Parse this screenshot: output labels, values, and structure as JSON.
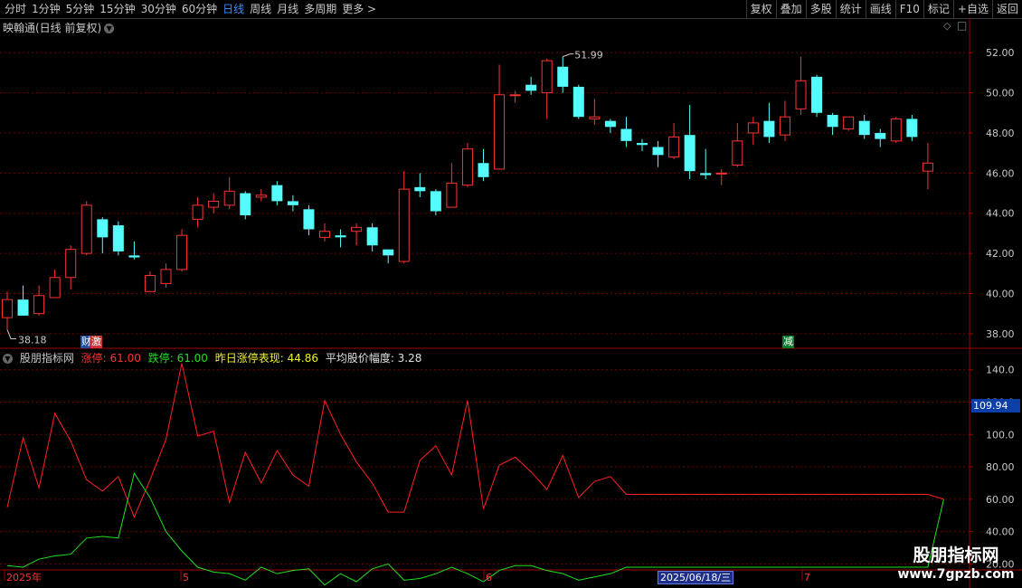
{
  "toolbar": {
    "periods": [
      "分时",
      "1分钟",
      "5分钟",
      "15分钟",
      "30分钟",
      "60分钟",
      "日线",
      "周线",
      "月线",
      "多周期",
      "更多 >"
    ],
    "active_period": "日线",
    "tools": [
      "复权",
      "叠加",
      "多股",
      "统计",
      "画线",
      "F10",
      "标记",
      "+自选",
      "返回"
    ]
  },
  "main_chart": {
    "title": "映翰通(日线 前复权)",
    "price_axis": [
      "52.00",
      "50.00",
      "48.00",
      "46.00",
      "44.00",
      "42.00",
      "40.00",
      "38.00"
    ],
    "high_label": "51.99",
    "low_label": "38.18",
    "badges": {
      "cai": "财",
      "ji": "激",
      "jian": "减"
    }
  },
  "indicator": {
    "name": "股朋指标网",
    "zt": "涨停: 61.00",
    "dt": "跌停: 61.00",
    "zrzt": "昨日涨停表现: 44.86",
    "avg": "平均股价幅度: 3.28",
    "axis": [
      "140.0",
      "120.0",
      "100.0",
      "80.00",
      "60.00",
      "40.00",
      "20.00"
    ],
    "current_value": "109.94"
  },
  "date_axis": {
    "labels": [
      "2025年",
      "5",
      "6",
      "7"
    ],
    "highlight": "2025/06/18/三"
  },
  "watermark": {
    "line1": "股朋指标网",
    "line2": "www.7gpzb.com"
  },
  "colors": {
    "up": "#ff3232",
    "down": "#54fcfc",
    "red_line": "#ff2020",
    "green_line": "#20e020",
    "grid": "#6e0000",
    "axis": "#a00000"
  },
  "chart_data": {
    "type": "candlestick",
    "ylim": [
      37.5,
      53
    ],
    "candles": [
      [
        38.8,
        39.7,
        40.1,
        38.2
      ],
      [
        39.7,
        38.9,
        40.4,
        38.9
      ],
      [
        39.0,
        39.9,
        40.4,
        38.9
      ],
      [
        39.8,
        40.8,
        41.2,
        39.8
      ],
      [
        40.8,
        42.2,
        42.4,
        40.2
      ],
      [
        42.0,
        44.4,
        44.6,
        41.9
      ],
      [
        43.7,
        42.8,
        43.8,
        42.0
      ],
      [
        43.4,
        42.1,
        43.6,
        41.9
      ],
      [
        41.9,
        41.8,
        42.6,
        41.7
      ],
      [
        40.1,
        40.9,
        41.1,
        40.1
      ],
      [
        40.5,
        41.2,
        41.5,
        40.3
      ],
      [
        41.2,
        42.9,
        43.2,
        41.1
      ],
      [
        43.7,
        44.4,
        44.8,
        43.3
      ],
      [
        44.3,
        44.6,
        45.0,
        44.0
      ],
      [
        44.4,
        45.1,
        45.8,
        44.2
      ],
      [
        45.0,
        43.9,
        45.1,
        43.7
      ],
      [
        44.8,
        44.9,
        45.2,
        44.6
      ],
      [
        45.4,
        44.6,
        45.6,
        44.4
      ],
      [
        44.6,
        44.4,
        44.9,
        44.1
      ],
      [
        44.2,
        43.2,
        44.4,
        42.9
      ],
      [
        42.8,
        43.1,
        43.5,
        42.6
      ],
      [
        42.9,
        42.8,
        43.2,
        42.3
      ],
      [
        43.1,
        43.3,
        43.5,
        42.4
      ],
      [
        43.3,
        42.4,
        43.5,
        42.1
      ],
      [
        42.2,
        41.9,
        42.2,
        41.5
      ],
      [
        41.6,
        45.2,
        46.1,
        41.5
      ],
      [
        45.3,
        45.1,
        46.0,
        44.8
      ],
      [
        45.1,
        44.1,
        45.2,
        43.9
      ],
      [
        44.3,
        45.5,
        46.5,
        44.3
      ],
      [
        45.4,
        47.2,
        47.5,
        45.3
      ],
      [
        46.5,
        45.8,
        47.2,
        45.6
      ],
      [
        46.2,
        49.9,
        51.4,
        46.2
      ],
      [
        49.9,
        49.9,
        50.1,
        49.5
      ],
      [
        50.4,
        50.1,
        50.8,
        49.9
      ],
      [
        50.0,
        51.6,
        51.7,
        48.7
      ],
      [
        51.3,
        50.3,
        51.8,
        50.0
      ],
      [
        50.3,
        48.8,
        50.4,
        48.7
      ],
      [
        48.7,
        48.8,
        49.7,
        48.4
      ],
      [
        48.6,
        48.3,
        48.7,
        48.0
      ],
      [
        48.2,
        47.6,
        48.8,
        47.3
      ],
      [
        47.5,
        47.4,
        47.7,
        47.1
      ],
      [
        47.3,
        46.9,
        47.6,
        46.3
      ],
      [
        46.8,
        47.8,
        48.5,
        46.7
      ],
      [
        47.9,
        46.1,
        49.4,
        45.7
      ],
      [
        46.0,
        45.9,
        47.2,
        45.7
      ],
      [
        46.0,
        46.0,
        46.2,
        45.4
      ],
      [
        46.4,
        47.6,
        48.5,
        46.3
      ],
      [
        48.0,
        48.5,
        48.8,
        47.4
      ],
      [
        48.6,
        47.8,
        49.5,
        47.5
      ],
      [
        47.9,
        48.8,
        49.6,
        47.6
      ],
      [
        49.2,
        50.6,
        51.8,
        48.9
      ],
      [
        50.8,
        49.0,
        50.9,
        48.8
      ],
      [
        48.9,
        48.3,
        49.0,
        47.9
      ],
      [
        48.2,
        48.8,
        48.8,
        48.1
      ],
      [
        48.6,
        47.9,
        48.9,
        47.7
      ],
      [
        48.0,
        47.7,
        48.2,
        47.3
      ],
      [
        47.6,
        48.7,
        48.8,
        47.5
      ],
      [
        48.7,
        47.8,
        48.9,
        47.6
      ],
      [
        46.1,
        46.5,
        47.5,
        45.2
      ]
    ],
    "indicator_ylim": [
      18,
      146
    ],
    "red_series": [
      55,
      98,
      67,
      113,
      96,
      72,
      65,
      74,
      49,
      72,
      97,
      144,
      99,
      102,
      58,
      89,
      70,
      90,
      75,
      68,
      121,
      100,
      83,
      70,
      52,
      52,
      84,
      93,
      75,
      121,
      54,
      81,
      86,
      77,
      66,
      87,
      61,
      71,
      74,
      63,
      63,
      63,
      63,
      63,
      63,
      63,
      63,
      63,
      63,
      63,
      63,
      63,
      63,
      63,
      63,
      63,
      63,
      63,
      63,
      60
    ],
    "green_series": [
      19,
      18,
      23,
      25,
      26,
      36,
      37,
      36,
      76,
      61,
      40,
      28,
      18,
      15,
      14,
      10,
      18,
      14,
      16,
      17,
      7,
      14,
      9,
      17,
      20,
      10,
      11,
      14,
      18,
      14,
      9,
      16,
      19,
      19,
      16,
      14,
      10,
      12,
      14,
      18,
      18,
      18,
      18,
      18,
      18,
      18,
      18,
      18,
      18,
      18,
      18,
      18,
      18,
      18,
      18,
      18,
      18,
      18,
      18,
      60
    ]
  }
}
